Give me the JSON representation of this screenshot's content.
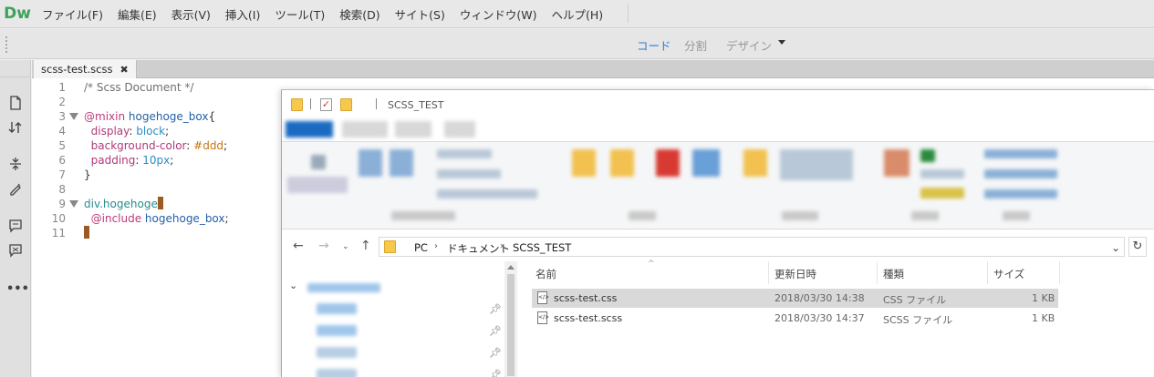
{
  "app": {
    "logo": "Dw",
    "menu": [
      "ファイル(F)",
      "編集(E)",
      "表示(V)",
      "挿入(I)",
      "ツール(T)",
      "検索(D)",
      "サイト(S)",
      "ウィンドウ(W)",
      "ヘルプ(H)"
    ]
  },
  "viewbar": {
    "code": "コード",
    "split": "分割",
    "design": "デザイン",
    "active": "code"
  },
  "document": {
    "tab_label": "scss-test.scss",
    "tab_close": "✖",
    "lines": [
      {
        "n": "1",
        "tokens": [
          {
            "t": "/* Scss Document */",
            "k": "comment"
          }
        ]
      },
      {
        "n": "2",
        "tokens": []
      },
      {
        "n": "3",
        "fold": true,
        "tokens": [
          {
            "t": "@mixin",
            "k": "at"
          },
          {
            "t": " hogehoge_box",
            "k": "name"
          },
          {
            "t": "{",
            "k": "plain"
          }
        ]
      },
      {
        "n": "4",
        "tokens": [
          {
            "t": "  display",
            "k": "prop"
          },
          {
            "t": ": ",
            "k": "plain"
          },
          {
            "t": "block",
            "k": "val"
          },
          {
            "t": ";",
            "k": "plain"
          }
        ]
      },
      {
        "n": "5",
        "tokens": [
          {
            "t": "  background-color",
            "k": "prop"
          },
          {
            "t": ": ",
            "k": "plain"
          },
          {
            "t": "#ddd",
            "k": "num"
          },
          {
            "t": ";",
            "k": "plain"
          }
        ]
      },
      {
        "n": "6",
        "tokens": [
          {
            "t": "  padding",
            "k": "prop"
          },
          {
            "t": ": ",
            "k": "plain"
          },
          {
            "t": "10px",
            "k": "val"
          },
          {
            "t": ";",
            "k": "plain"
          }
        ]
      },
      {
        "n": "7",
        "tokens": [
          {
            "t": "}",
            "k": "plain"
          }
        ]
      },
      {
        "n": "8",
        "tokens": []
      },
      {
        "n": "9",
        "fold": true,
        "tokens": [
          {
            "t": "div.hogehoge",
            "k": "sel"
          }
        ],
        "caret": true
      },
      {
        "n": "10",
        "tokens": [
          {
            "t": "  @include",
            "k": "at"
          },
          {
            "t": " hogehoge_box",
            "k": "name"
          },
          {
            "t": ";",
            "k": "plain"
          }
        ]
      },
      {
        "n": "11",
        "tokens": [],
        "caret": true
      }
    ]
  },
  "explorer": {
    "title": "SCSS_TEST",
    "address": [
      "PC",
      "ドキュメント",
      "SCSS_TEST"
    ],
    "columns": [
      "名前",
      "更新日時",
      "種類",
      "サイズ"
    ],
    "files": [
      {
        "name": "scss-test.css",
        "modified": "2018/03/30 14:38",
        "type": "CSS ファイル",
        "size": "1 KB",
        "selected": true
      },
      {
        "name": "scss-test.scss",
        "modified": "2018/03/30 14:37",
        "type": "SCSS ファイル",
        "size": "1 KB",
        "selected": false
      }
    ]
  },
  "icons": [
    "new-file-icon",
    "sort-icon",
    "expand-icon",
    "format-icon",
    "comment-icon",
    "uncomment-icon",
    "more-icon",
    "folder-icon",
    "checkmark-icon",
    "back-icon",
    "forward-icon",
    "up-icon",
    "refresh-icon",
    "pin-icon"
  ]
}
